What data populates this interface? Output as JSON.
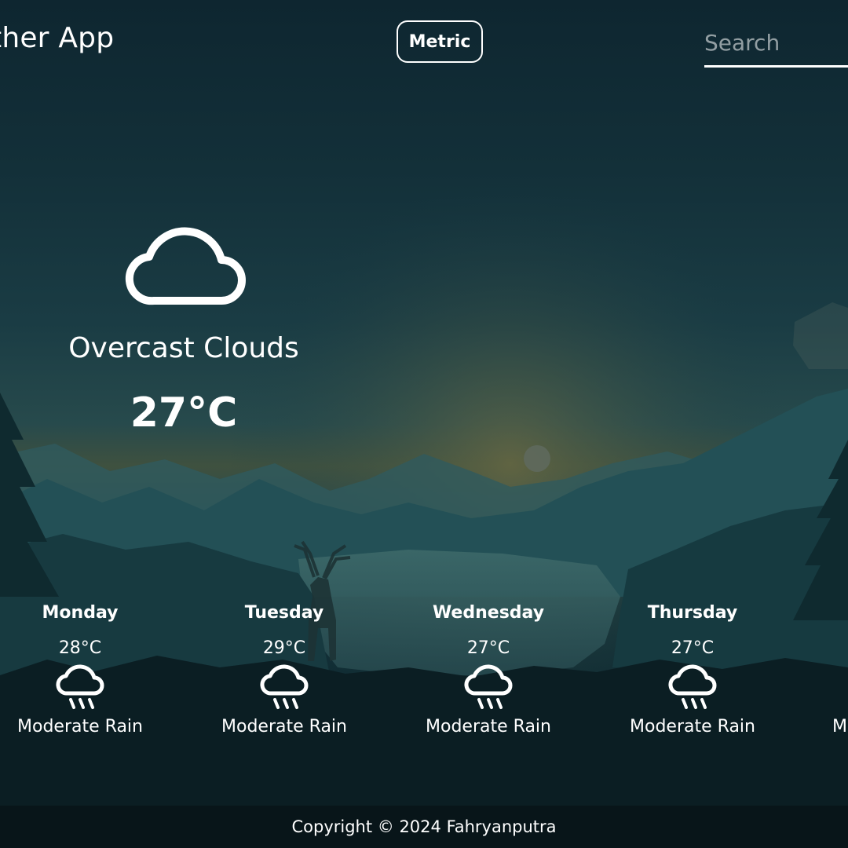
{
  "header": {
    "title": "ther App",
    "units_label": "Metric",
    "search_placeholder": "Search"
  },
  "current": {
    "icon": "cloud-icon",
    "description": "Overcast Clouds",
    "temperature": "27°C"
  },
  "forecast": [
    {
      "day": "Monday",
      "temp": "28°C",
      "icon": "rain-icon",
      "description": "Moderate Rain"
    },
    {
      "day": "Tuesday",
      "temp": "29°C",
      "icon": "rain-icon",
      "description": "Moderate Rain"
    },
    {
      "day": "Wednesday",
      "temp": "27°C",
      "icon": "rain-icon",
      "description": "Moderate Rain"
    },
    {
      "day": "Thursday",
      "temp": "27°C",
      "icon": "rain-icon",
      "description": "Moderate Rain"
    },
    {
      "day": "",
      "temp": "",
      "icon": "",
      "description": "Mo"
    }
  ],
  "footer": {
    "copyright": "Copyright © 2024 Fahryanputra"
  },
  "colors": {
    "text": "#ffffff",
    "footer_background": "#081519",
    "sky_top": "#0e2630",
    "horizon_glow": "#4a5a3c"
  }
}
